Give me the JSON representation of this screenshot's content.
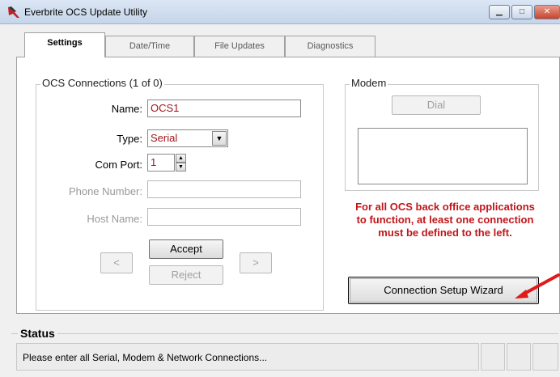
{
  "window": {
    "title": "Everbrite OCS Update Utility"
  },
  "tabs": [
    {
      "label": "Settings",
      "active": true
    },
    {
      "label": "Date/Time"
    },
    {
      "label": "File Updates"
    },
    {
      "label": "Diagnostics"
    }
  ],
  "connections": {
    "title": "OCS Connections (1 of 0)",
    "name": {
      "label": "Name:",
      "value": "OCS1"
    },
    "type": {
      "label": "Type:",
      "value": "Serial"
    },
    "com_port": {
      "label": "Com Port:",
      "value": "1"
    },
    "phone_number": {
      "label": "Phone Number:",
      "value": ""
    },
    "host_name": {
      "label": "Host Name:",
      "value": ""
    },
    "prev_label": "<",
    "next_label": ">",
    "accept_label": "Accept",
    "reject_label": "Reject"
  },
  "modem": {
    "title": "Modem",
    "dial_label": "Dial"
  },
  "warning": "For all OCS back office applications to function, at least one connection must be defined to the left.",
  "wizard_label": "Connection Setup Wizard",
  "status": {
    "title": "Status",
    "text": "Please enter all Serial, Modem & Network Connections..."
  },
  "icons": {
    "app": "app-icon",
    "minimize": "minimize-icon",
    "maximize": "maximize-icon",
    "close": "close-icon",
    "dropdown": "chevron-down-icon",
    "spin_up": "spin-up-icon",
    "spin_down": "spin-down-icon"
  },
  "colors": {
    "warning_text": "#c0161a",
    "input_text": "#a0161a",
    "annotation_arrow": "#e11919"
  }
}
